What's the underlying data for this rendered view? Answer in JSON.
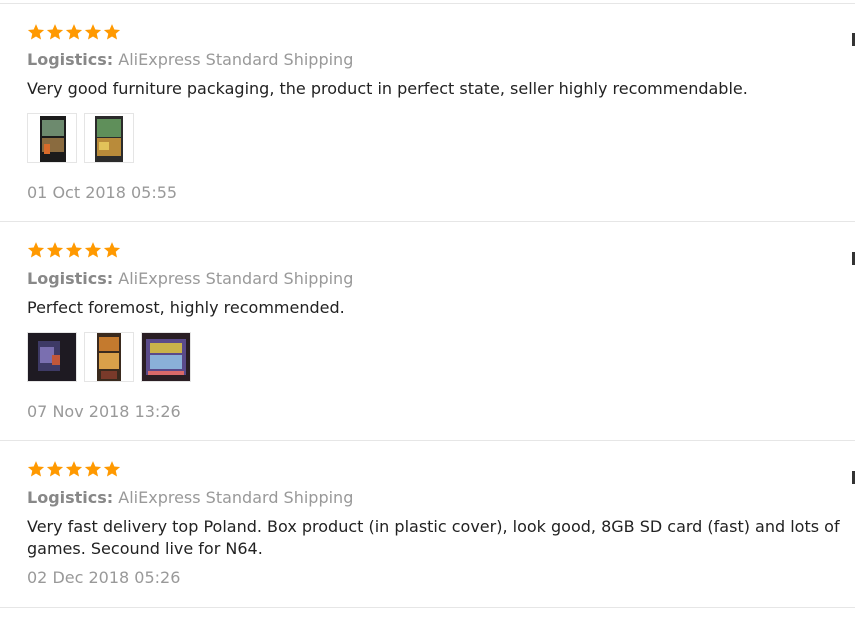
{
  "colors": {
    "star": "#f90",
    "text": "#222222",
    "muted": "#999999",
    "divider": "#e6e6e6"
  },
  "reviews": [
    {
      "rating": 5,
      "logistics_label": "Logistics:",
      "logistics_value": "AliExpress Standard Shipping",
      "text": "Very good furniture packaging, the product in perfect state, seller highly recommendable.",
      "date": "01 Oct 2018 05:55",
      "photo_count": 2
    },
    {
      "rating": 5,
      "logistics_label": "Logistics:",
      "logistics_value": "AliExpress Standard Shipping",
      "text": "Perfect foremost, highly recommended.",
      "date": "07 Nov 2018 13:26",
      "photo_count": 3
    },
    {
      "rating": 5,
      "logistics_label": "Logistics:",
      "logistics_value": "AliExpress Standard Shipping",
      "text": "Very fast delivery top Poland. Box product (in plastic cover), look good, 8GB SD card (fast) and lots of games. Secound live for N64.",
      "date": "02 Dec 2018 05:26",
      "photo_count": 0
    }
  ]
}
